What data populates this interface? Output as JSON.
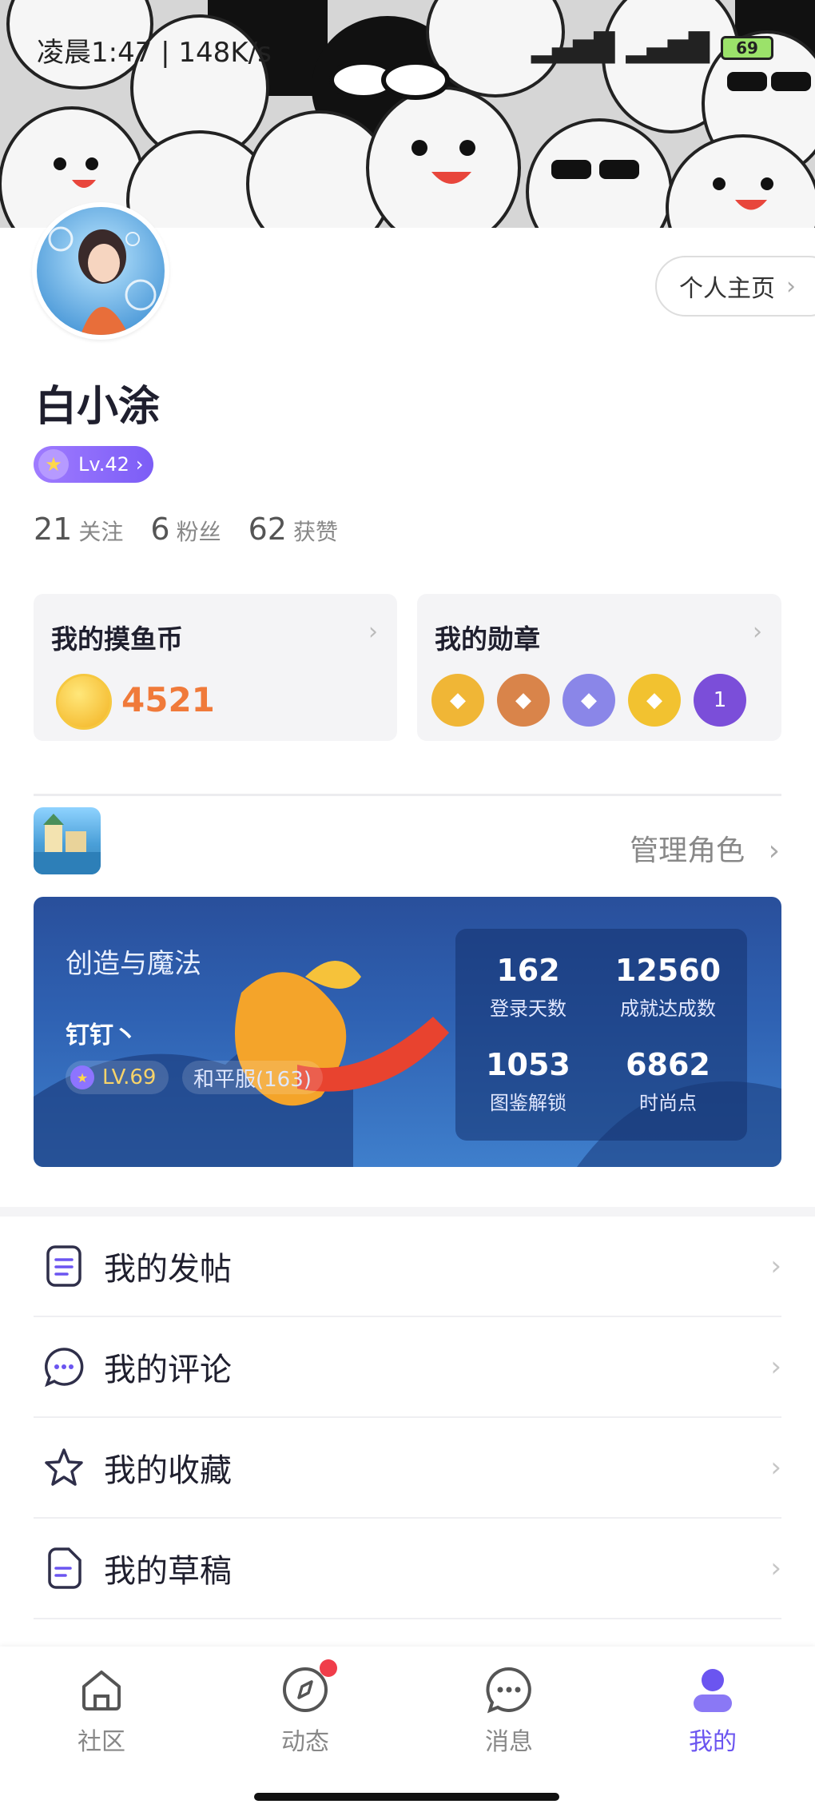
{
  "status_bar": {
    "time_text": "凌晨1:47 | 148K/s",
    "battery": "69"
  },
  "profile": {
    "homepage_button": "个人主页",
    "username": "白小涂",
    "level": "Lv.42",
    "stats": [
      {
        "value": "21",
        "label": "关注"
      },
      {
        "value": "6",
        "label": "粉丝"
      },
      {
        "value": "62",
        "label": "获赞"
      }
    ]
  },
  "coins_card": {
    "title": "我的摸鱼币",
    "value": "4521"
  },
  "medals_card": {
    "title": "我的勋章",
    "medals": [
      {
        "icon": "fish-medal-icon",
        "color": "#f0b636"
      },
      {
        "icon": "fish-medal-icon",
        "color": "#d9844a"
      },
      {
        "icon": "fish-medal-icon",
        "color": "#8a86e8"
      },
      {
        "icon": "fish-medal-icon",
        "color": "#f2c230"
      },
      {
        "icon": "anniversary-medal-icon",
        "color": "#7b4ed9"
      }
    ]
  },
  "game_section": {
    "manage_roles": "管理角色",
    "game_title": "创造与魔法",
    "role_name": "钉钉丶",
    "role_level": "LV.69",
    "server": "和平服(163)",
    "stats": [
      {
        "value": "162",
        "label": "登录天数"
      },
      {
        "value": "12560",
        "label": "成就达成数"
      },
      {
        "value": "1053",
        "label": "图鉴解锁"
      },
      {
        "value": "6862",
        "label": "时尚点"
      }
    ]
  },
  "menu": [
    {
      "label": "我的发帖",
      "icon": "document-icon"
    },
    {
      "label": "我的评论",
      "icon": "comment-icon"
    },
    {
      "label": "我的收藏",
      "icon": "star-icon"
    },
    {
      "label": "我的草稿",
      "icon": "draft-icon"
    }
  ],
  "bottom_nav": [
    {
      "label": "社区",
      "icon": "home-icon"
    },
    {
      "label": "动态",
      "icon": "compass-icon",
      "badge": true
    },
    {
      "label": "消息",
      "icon": "chat-icon"
    },
    {
      "label": "我的",
      "icon": "profile-icon",
      "active": true
    }
  ],
  "colors": {
    "accent": "#6b55f0",
    "coin_value": "#f07a3a",
    "badge_red": "#f03d4a"
  }
}
